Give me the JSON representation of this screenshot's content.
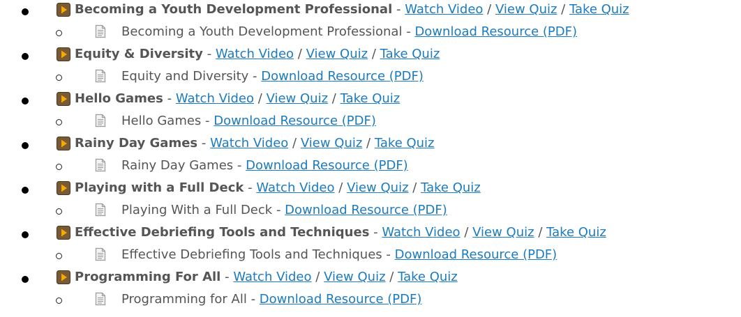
{
  "labels": {
    "watch_video": "Watch Video",
    "view_quiz": "View Quiz",
    "take_quiz": "Take Quiz",
    "download_resource": "Download Resource (PDF)",
    "dash": "-",
    "slash": "/"
  },
  "colors": {
    "link": "#1a7bc0",
    "text": "#555555",
    "video_icon_bg": "#7a5a33",
    "video_icon_play": "#f2a900",
    "doc_icon": "#9a9a9a"
  },
  "icons": {
    "video": "play-video-icon",
    "document": "document-icon"
  },
  "modules": [
    {
      "title": "Becoming a Youth Development Professional",
      "resource": "Becoming a Youth Development Professional"
    },
    {
      "title": "Equity & Diversity",
      "resource": "Equity and Diversity"
    },
    {
      "title": "Hello Games",
      "resource": "Hello Games"
    },
    {
      "title": "Rainy Day Games",
      "resource": "Rainy Day Games"
    },
    {
      "title": "Playing with a Full Deck",
      "resource": "Playing With a Full Deck"
    },
    {
      "title": "Effective Debriefing Tools and Techniques",
      "resource": "Effective Debriefing Tools and Techniques"
    },
    {
      "title": "Programming For All",
      "resource": "Programming for All"
    }
  ]
}
